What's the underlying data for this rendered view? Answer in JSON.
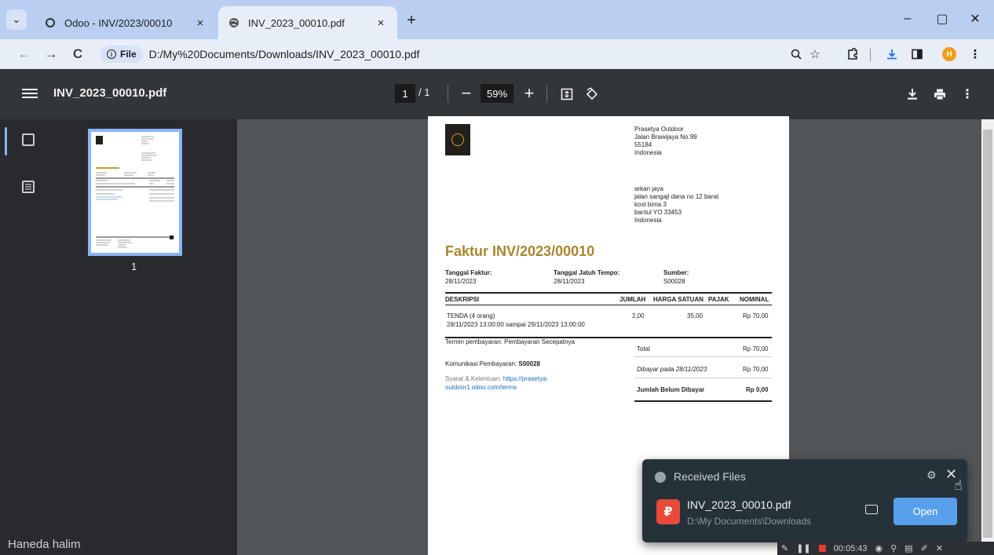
{
  "browser": {
    "tabs": [
      {
        "title": "Odoo - INV/2023/00010",
        "close": "×"
      },
      {
        "title": "INV_2023_00010.pdf",
        "close": "×"
      }
    ],
    "new_tab": "+",
    "window_controls": {
      "minimize": "–",
      "restore": "▢",
      "close": "✕"
    },
    "nav": {
      "back": "←",
      "forward": "→",
      "reload": "C"
    },
    "address": {
      "chip_icon": "i",
      "chip_label": "File",
      "url": "D:/My%20Documents/Downloads/INV_2023_00010.pdf"
    },
    "toolbar_icons": [
      "zoom-icon",
      "star-icon",
      "extensions-icon",
      "download-icon",
      "sidepanel-icon",
      "profile-avatar",
      "menu-icon"
    ],
    "profile_initial": "H"
  },
  "pdf_viewer": {
    "filename": "INV_2023_00010.pdf",
    "current_page": "1",
    "page_sep": "/ 1",
    "zoom": "59%",
    "zoom_out": "−",
    "zoom_in": "+",
    "thumbnail_number": "1",
    "watermark": "Haneda halim"
  },
  "invoice": {
    "company_address": [
      "Prasetya Outdoor",
      "Jalan Brawijaya No.99",
      "55184",
      "Indonesia"
    ],
    "customer_address": [
      "arkan jaya",
      "jalan sangaji dana no 12 barat",
      "kost bima 3",
      "bantul YO 33453",
      "Indonesia"
    ],
    "title": "Faktur INV/2023/00010",
    "meta": {
      "invoice_date_label": "Tanggal Faktur:",
      "invoice_date": "28/11/2023",
      "due_date_label": "Tanggal Jatuh Tempo:",
      "due_date": "28/11/2023",
      "source_label": "Sumber:",
      "source": "S00028"
    },
    "columns": [
      "DESKRIPSI",
      "JUMLAH",
      "HARGA SATUAN",
      "PAJAK",
      "NOMINAL"
    ],
    "line": {
      "description": "TENDA (4 orang)",
      "period": "28/11/2023 13:00:00 sampai 29/11/2023 13:00:00",
      "qty": "2,00",
      "unit_price": "35,00",
      "tax": "",
      "amount": "Rp 70,00"
    },
    "payment_terms": "Termin pembayaran: Pembayaran Secepatnya",
    "payment_comm_label": "Komunikasi Pembayaran:",
    "payment_comm": "S00028",
    "terms_label": "Syarat & Ketentuan:",
    "terms_link_1": "https://prasetya-",
    "terms_link_2": "outdoor1.odoo.com/terms",
    "totals": {
      "total_label": "Total",
      "total": "Rp 70,00",
      "paid_label": "Dibayar pada 28/11/2023",
      "paid": "Rp 70,00",
      "due_label": "Jumlah Belum Dibayar",
      "due": "Rp 0,00"
    }
  },
  "notification": {
    "title": "Received Files",
    "file": "INV_2023_00010.pdf",
    "path": "D:\\My Documents\\Downloads",
    "open": "Open",
    "close": "✕",
    "gear": "⚙"
  },
  "recorder": {
    "time": "00:05:43"
  },
  "colors": {
    "accent": "#8ab4f8",
    "invoice_title": "#a8862d",
    "open_button": "#58a0ec",
    "pdf_badge": "#e74a3b"
  }
}
